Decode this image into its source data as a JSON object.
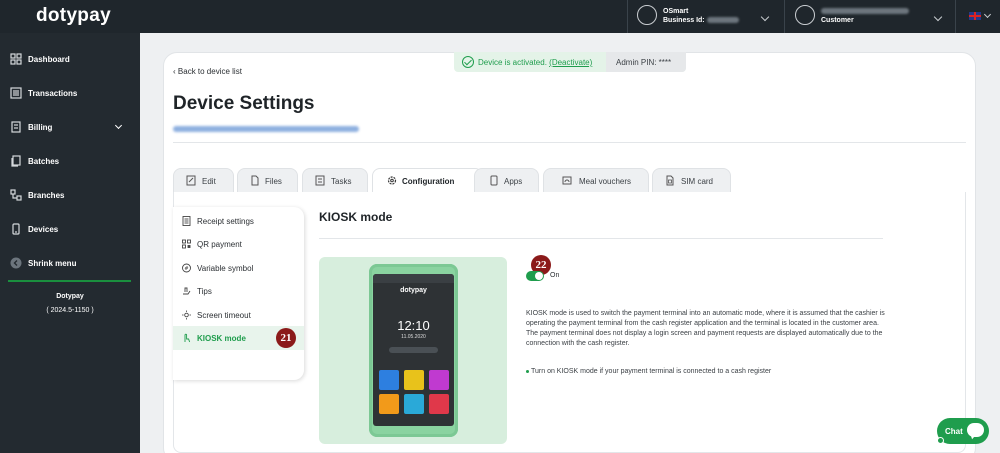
{
  "app": {
    "logo": "dotypay"
  },
  "header": {
    "account": {
      "name": "OSmart",
      "business_label": "Business Id:"
    },
    "user": {
      "role": "Customer"
    },
    "language": "en-gb"
  },
  "sidebar": {
    "items": [
      {
        "label": "Dashboard",
        "icon": "dashboard-icon"
      },
      {
        "label": "Transactions",
        "icon": "transactions-icon"
      },
      {
        "label": "Billing",
        "icon": "billing-icon"
      },
      {
        "label": "Batches",
        "icon": "batches-icon"
      },
      {
        "label": "Branches",
        "icon": "branches-icon"
      },
      {
        "label": "Devices",
        "icon": "devices-icon"
      },
      {
        "label": "Shrink menu",
        "icon": "shrink-icon"
      }
    ],
    "footer": {
      "company": "Dotypay",
      "version": "( 2024.5-1150 )"
    }
  },
  "status": {
    "activated_text": "Device is activated.",
    "deactivate_link": "(Deactivate)",
    "admin_pin": "Admin PIN: ****"
  },
  "page": {
    "back_link": "Back to device list",
    "title": "Device Settings"
  },
  "tabs": [
    {
      "label": "Edit"
    },
    {
      "label": "Files"
    },
    {
      "label": "Tasks"
    },
    {
      "label": "Configuration"
    },
    {
      "label": "Apps"
    },
    {
      "label": "Meal vouchers"
    },
    {
      "label": "SIM card"
    }
  ],
  "config_menu": [
    {
      "label": "Receipt settings"
    },
    {
      "label": "QR payment"
    },
    {
      "label": "Variable symbol"
    },
    {
      "label": "Tips"
    },
    {
      "label": "Screen timeout"
    },
    {
      "label": "KIOSK mode"
    }
  ],
  "kiosk": {
    "title": "KIOSK mode",
    "toggle_label": "On",
    "toggle_on": true,
    "description_1": "KIOSK mode is used to switch the payment terminal into an automatic mode, where it is assumed that the cashier is operating the payment terminal from the cash register application and the terminal is located in the customer area.",
    "description_2": "The payment terminal does not display a login screen and payment requests are displayed automatically due to the connection with the cash register.",
    "bullet": "Turn on KIOSK mode if your payment terminal is connected to a cash register"
  },
  "terminal": {
    "brand": "dotypay",
    "time": "12:10",
    "date": "11.05.2020"
  },
  "badges": {
    "menu_marker": "21",
    "toggle_marker": "22"
  },
  "chat": {
    "label": "Chat"
  },
  "colors": {
    "accent": "#1f9d4d",
    "sidebar": "#232a30",
    "badge": "#8b1a1a"
  }
}
